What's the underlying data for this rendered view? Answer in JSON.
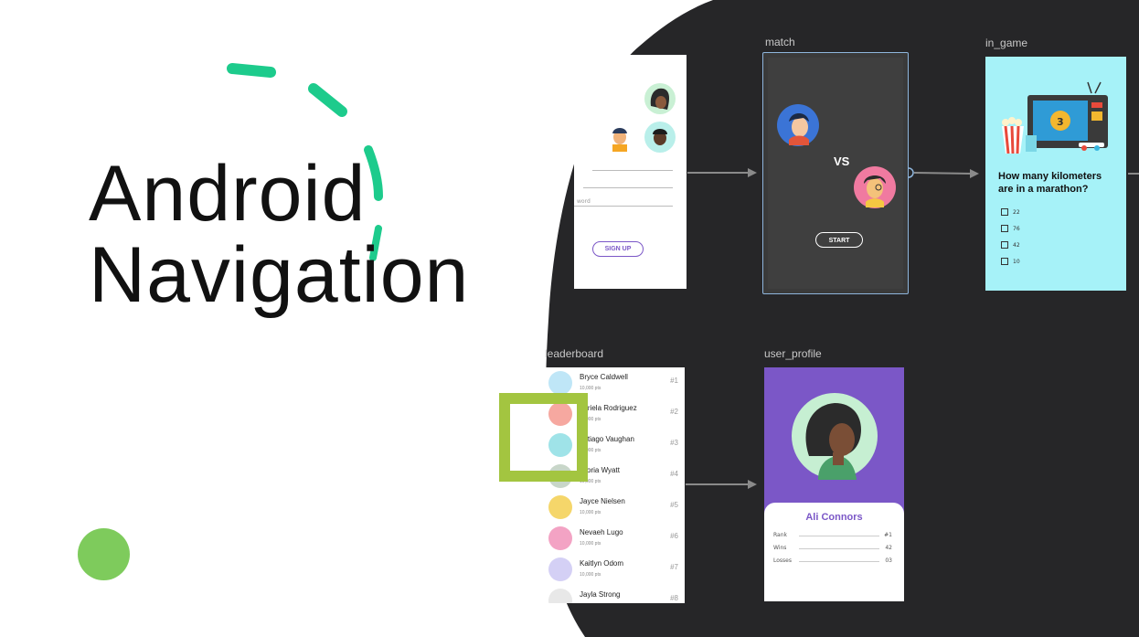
{
  "slide": {
    "title_line1": "Android",
    "title_line2": "Navigation",
    "colors": {
      "accent_teal": "#1dcb8c",
      "accent_green": "#7ecb5c",
      "canvas_dark": "#262628",
      "highlight_box": "#a3c540"
    }
  },
  "graph": {
    "labels": {
      "match": "match",
      "in_game": "in_game",
      "leaderboard": "leaderboard",
      "user_profile": "user_profile"
    }
  },
  "login": {
    "password_placeholder": "word",
    "signup_label": "SIGN UP"
  },
  "match": {
    "vs_label": "VS",
    "start_label": "START"
  },
  "in_game": {
    "question": "How many kilometers are in a marathon?",
    "options": [
      "22",
      "76",
      "42",
      "10"
    ]
  },
  "leaderboard": {
    "rows": [
      {
        "name": "Bryce Caldwell",
        "pts": "10,000 pts",
        "rank": "#1"
      },
      {
        "name": "abriela Rodriguez",
        "pts": "10,000 pts",
        "rank": "#2"
      },
      {
        "name": "antiago Vaughan",
        "pts": "10,000 pts",
        "rank": "#3"
      },
      {
        "name": "ictoria Wyatt",
        "pts": "10,000 pts",
        "rank": "#4"
      },
      {
        "name": "Jayce Nielsen",
        "pts": "10,000 pts",
        "rank": "#5"
      },
      {
        "name": "Nevaeh Lugo",
        "pts": "10,000 pts",
        "rank": "#6"
      },
      {
        "name": "Kaitlyn Odom",
        "pts": "10,000 pts",
        "rank": "#7"
      },
      {
        "name": "Jayla Strong",
        "pts": "",
        "rank": "#8"
      }
    ]
  },
  "user_profile": {
    "name": "Ali Connors",
    "stats": [
      {
        "label": "Rank",
        "value": "#1"
      },
      {
        "label": "Wins",
        "value": "42"
      },
      {
        "label": "Losses",
        "value": "03"
      }
    ]
  }
}
